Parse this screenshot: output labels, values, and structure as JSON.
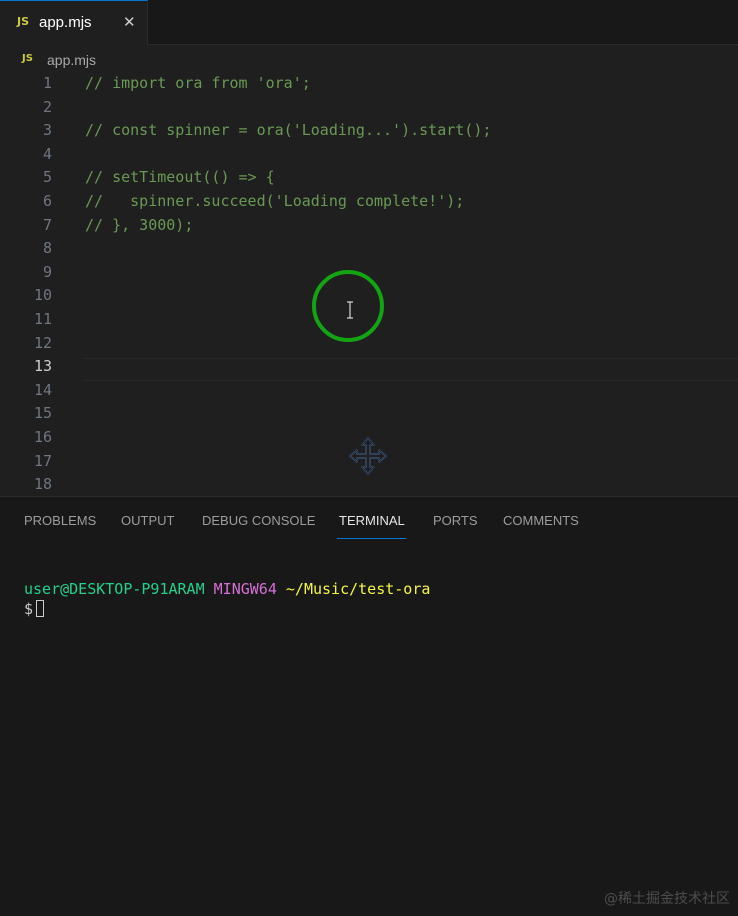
{
  "tabs": [
    {
      "icon": "JS",
      "label": "app.mjs",
      "close": "✕"
    }
  ],
  "breadcrumb": {
    "icon": "JS",
    "label": "app.mjs"
  },
  "editor": {
    "lines": [
      {
        "n": "1",
        "text": "// import ora from 'ora';"
      },
      {
        "n": "2",
        "text": ""
      },
      {
        "n": "3",
        "text": "// const spinner = ora('Loading...').start();"
      },
      {
        "n": "4",
        "text": ""
      },
      {
        "n": "5",
        "text": "// setTimeout(() => {"
      },
      {
        "n": "6",
        "text": "//   spinner.succeed('Loading complete!');"
      },
      {
        "n": "7",
        "text": "// }, 3000);"
      },
      {
        "n": "8",
        "text": ""
      },
      {
        "n": "9",
        "text": ""
      },
      {
        "n": "10",
        "text": ""
      },
      {
        "n": "11",
        "text": ""
      },
      {
        "n": "12",
        "text": ""
      },
      {
        "n": "13",
        "text": ""
      },
      {
        "n": "14",
        "text": ""
      },
      {
        "n": "15",
        "text": ""
      },
      {
        "n": "16",
        "text": ""
      },
      {
        "n": "17",
        "text": ""
      },
      {
        "n": "18",
        "text": ""
      }
    ],
    "active_line": "13"
  },
  "panel": {
    "tabs": [
      {
        "label": "PROBLEMS"
      },
      {
        "label": "OUTPUT"
      },
      {
        "label": "DEBUG CONSOLE"
      },
      {
        "label": "TERMINAL"
      },
      {
        "label": "PORTS"
      },
      {
        "label": "COMMENTS"
      }
    ],
    "active_tab": "TERMINAL"
  },
  "terminal": {
    "user": "user@DESKTOP-P91ARAM",
    "msys": "MINGW64",
    "path": "~/Music/test-ora",
    "prompt": "$"
  },
  "watermark": "@稀土掘金技术社区",
  "colors": {
    "comment": "#6a9955",
    "accent": "#0078d4",
    "cursor_ring": "#13a313",
    "terminal_user": "#23d18b",
    "terminal_msys": "#d670d6",
    "terminal_path": "#f5f543"
  }
}
